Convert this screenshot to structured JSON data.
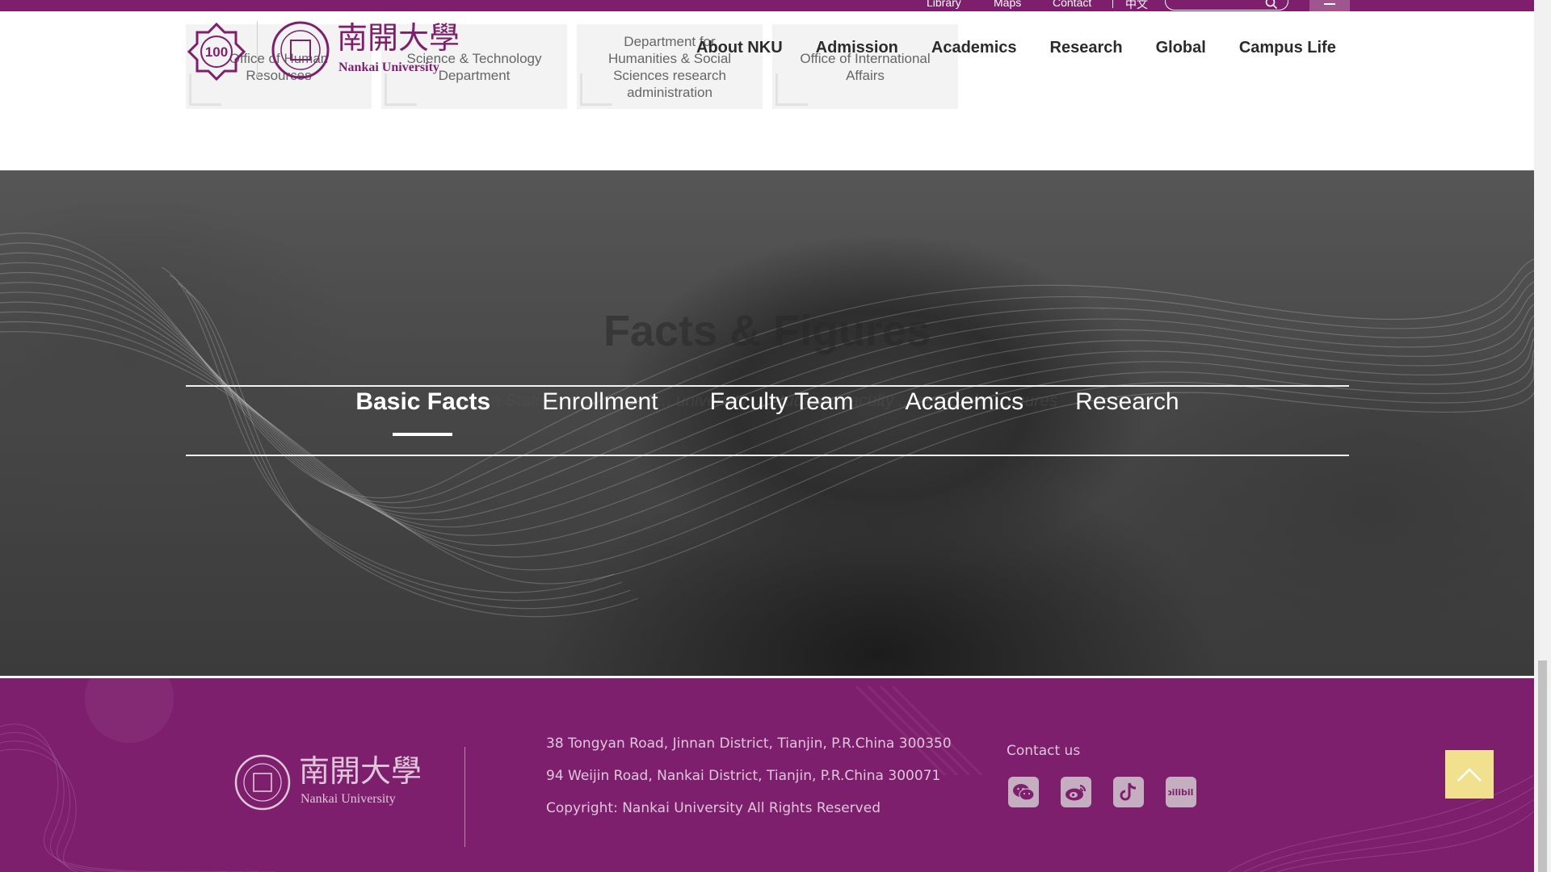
{
  "top_bar": {
    "links": [
      "Library",
      "Maps",
      "Contact"
    ],
    "language": "中文",
    "search": {
      "placeholder": ""
    }
  },
  "departments": [
    "Office of Human Resources",
    "Science & Technology Department",
    "Department for Humanities & Social Sciences research administration",
    "Office of International Affairs"
  ],
  "logo": {
    "badge_text": "100",
    "chinese_name": "南開大學",
    "english_name": "Nankai University"
  },
  "nav": {
    "items": [
      "About NKU",
      "Admission",
      "Academics",
      "Research",
      "Global",
      "Campus Life"
    ]
  },
  "hero": {
    "title": "Facts & Figures",
    "subtitle": "...a Statistical summary ... university ... students, faculty ... research ... figures",
    "tabs": [
      "Basic Facts",
      "Enrollment",
      "Faculty Team",
      "Academics",
      "Research"
    ],
    "active_tab": "Basic Facts"
  },
  "footer": {
    "logo_chinese": "南開大學",
    "logo_english": "Nankai University",
    "address_lines": [
      "38 Tongyan Road, Jinnan District, Tianjin, P.R.China 300350",
      "94 Weijin Road, Nankai District, Tianjin, P.R.China 300071",
      "Copyright: Nankai University All Rights Reserved"
    ],
    "contact_label": "Contact us",
    "social": [
      "wechat-icon",
      "weibo-icon",
      "tiktok-icon",
      "bilibili-icon"
    ],
    "bilibili_text": "bilibili"
  },
  "colors": {
    "brand_purple": "#7e1f6e",
    "footer_text": "#dfc7da",
    "back_to_top": "#f1e08e"
  }
}
